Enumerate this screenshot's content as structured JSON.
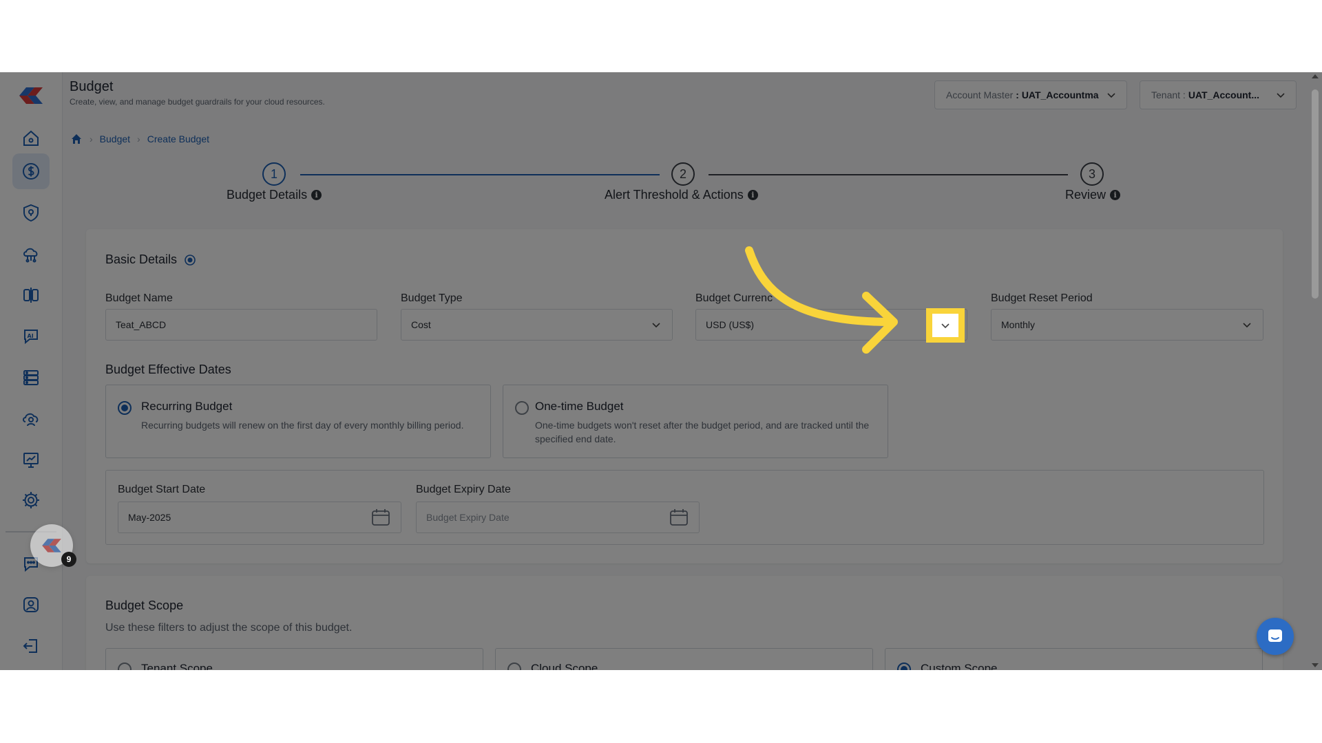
{
  "header": {
    "title": "Budget",
    "subtitle": "Create, view, and manage budget guardrails for your cloud resources.",
    "account_master": {
      "label": "Account Master",
      "value": ": UAT_Accountma"
    },
    "tenant": {
      "label": "Tenant :",
      "value": "UAT_Account..."
    }
  },
  "breadcrumb": {
    "home_icon": "home-icon",
    "items": [
      "Budget",
      "Create Budget"
    ]
  },
  "stepper": {
    "steps": [
      {
        "number": "1",
        "label": "Budget Details"
      },
      {
        "number": "2",
        "label": "Alert Threshold & Actions"
      },
      {
        "number": "3",
        "label": "Review"
      }
    ],
    "info_glyph": "i"
  },
  "basic_details": {
    "title": "Basic Details",
    "budget_name": {
      "label": "Budget Name",
      "value": "Teat_ABCD"
    },
    "budget_type": {
      "label": "Budget Type",
      "value": "Cost"
    },
    "budget_currency": {
      "label": "Budget Currenc",
      "value": "USD (US$)"
    },
    "budget_reset_period": {
      "label": "Budget Reset Period",
      "value": "Monthly"
    },
    "effective_dates": {
      "title": "Budget Effective Dates",
      "recurring": {
        "title": "Recurring Budget",
        "desc": "Recurring budgets will renew on the first day of every monthly billing period.",
        "selected": true
      },
      "one_time": {
        "title": "One-time Budget",
        "desc": "One-time budgets won't reset after the budget period, and are tracked until the specified end date.",
        "selected": false
      },
      "start_date": {
        "label": "Budget Start Date",
        "value": "May-2025"
      },
      "expiry_date": {
        "label": "Budget Expiry Date",
        "placeholder": "Budget Expiry Date"
      }
    }
  },
  "budget_scope": {
    "title": "Budget Scope",
    "subtitle": "Use these filters to adjust the scope of this budget.",
    "options": [
      {
        "label": "Tenant Scope",
        "selected": false
      },
      {
        "label": "Cloud Scope",
        "selected": false
      },
      {
        "label": "Custom Scope",
        "selected": true
      }
    ]
  },
  "floating": {
    "badge_count": "9"
  },
  "colors": {
    "accent": "#1c5fb3",
    "highlight": "#f9d43a",
    "chat": "#2c6cc4"
  }
}
